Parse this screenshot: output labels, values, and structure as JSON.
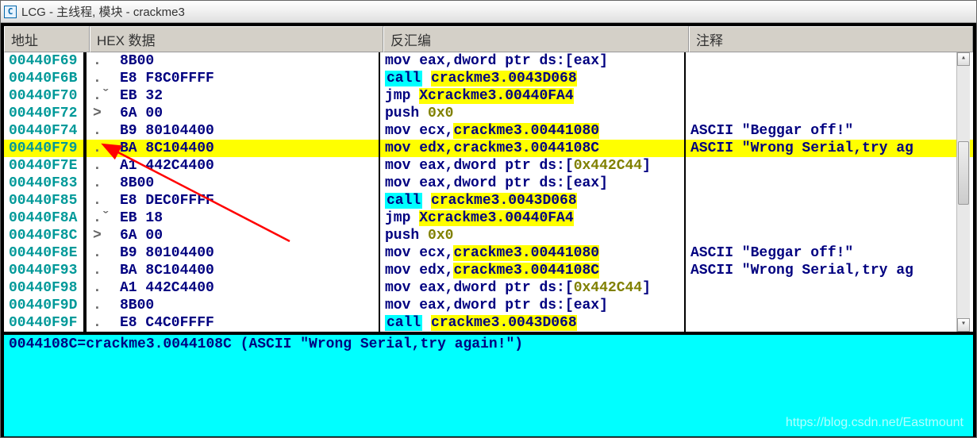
{
  "window": {
    "icon_letter": "C",
    "title": "LCG -  主线程, 模块 - crackme3"
  },
  "columns": {
    "addr": "地址",
    "hex": "HEX 数据",
    "dis": "反汇编",
    "comment": "注释"
  },
  "rows": [
    {
      "addr": "00440F69",
      "mark": ".",
      "bytes": "8B00",
      "dis": [
        [
          "mn",
          "mov "
        ],
        [
          "reg",
          "eax"
        ],
        [
          "op",
          ","
        ],
        [
          "reg",
          "dword ptr ds:"
        ],
        [
          "op",
          "["
        ],
        [
          "reg",
          "eax"
        ],
        [
          "op",
          "]"
        ]
      ],
      "comment": "",
      "sel": false
    },
    {
      "addr": "00440F6B",
      "mark": ".",
      "bytes": "E8 F8C0FFFF",
      "dis": [
        [
          "kw-call",
          "call"
        ],
        [
          "op",
          " "
        ],
        [
          "sym",
          "crackme3.0043D068"
        ]
      ],
      "comment": "",
      "sel": false
    },
    {
      "addr": "00440F70",
      "mark": ".ˇ",
      "bytes": "EB 32",
      "dis": [
        [
          "kw-jmp",
          "jmp "
        ],
        [
          "sym",
          "Xcrackme3.00440FA4"
        ]
      ],
      "comment": "",
      "sel": false
    },
    {
      "addr": "00440F72",
      "mark": ">",
      "bytes": "6A 00",
      "dis": [
        [
          "mn",
          "push "
        ],
        [
          "num",
          "0x0"
        ]
      ],
      "comment": "",
      "sel": false
    },
    {
      "addr": "00440F74",
      "mark": ".",
      "bytes": "B9 80104400",
      "dis": [
        [
          "mn",
          "mov "
        ],
        [
          "reg",
          "ecx"
        ],
        [
          "op",
          ","
        ],
        [
          "sym",
          "crackme3.00441080"
        ]
      ],
      "comment": "ASCII \"Beggar off!\"",
      "sel": false
    },
    {
      "addr": "00440F79",
      "mark": ".",
      "bytes": "BA 8C104400",
      "dis": [
        [
          "mn",
          "mov "
        ],
        [
          "reg",
          "edx"
        ],
        [
          "op",
          ","
        ],
        [
          "op",
          "crackme3.0044108C"
        ]
      ],
      "comment": "ASCII \"Wrong Serial,try ag",
      "sel": true
    },
    {
      "addr": "00440F7E",
      "mark": ".",
      "bytes": "A1 442C4400",
      "dis": [
        [
          "mn",
          "mov "
        ],
        [
          "reg",
          "eax"
        ],
        [
          "op",
          ","
        ],
        [
          "reg",
          "dword ptr ds:"
        ],
        [
          "op",
          "["
        ],
        [
          "num",
          "0x442C44"
        ],
        [
          "op",
          "]"
        ]
      ],
      "comment": "",
      "sel": false
    },
    {
      "addr": "00440F83",
      "mark": ".",
      "bytes": "8B00",
      "dis": [
        [
          "mn",
          "mov "
        ],
        [
          "reg",
          "eax"
        ],
        [
          "op",
          ","
        ],
        [
          "reg",
          "dword ptr ds:"
        ],
        [
          "op",
          "["
        ],
        [
          "reg",
          "eax"
        ],
        [
          "op",
          "]"
        ]
      ],
      "comment": "",
      "sel": false
    },
    {
      "addr": "00440F85",
      "mark": ".",
      "bytes": "E8 DEC0FFFF",
      "dis": [
        [
          "kw-call",
          "call"
        ],
        [
          "op",
          " "
        ],
        [
          "sym",
          "crackme3.0043D068"
        ]
      ],
      "comment": "",
      "sel": false
    },
    {
      "addr": "00440F8A",
      "mark": ".ˇ",
      "bytes": "EB 18",
      "dis": [
        [
          "kw-jmp",
          "jmp "
        ],
        [
          "sym",
          "Xcrackme3.00440FA4"
        ]
      ],
      "comment": "",
      "sel": false
    },
    {
      "addr": "00440F8C",
      "mark": ">",
      "bytes": "6A 00",
      "dis": [
        [
          "mn",
          "push "
        ],
        [
          "num",
          "0x0"
        ]
      ],
      "comment": "",
      "sel": false
    },
    {
      "addr": "00440F8E",
      "mark": ".",
      "bytes": "B9 80104400",
      "dis": [
        [
          "mn",
          "mov "
        ],
        [
          "reg",
          "ecx"
        ],
        [
          "op",
          ","
        ],
        [
          "sym",
          "crackme3.00441080"
        ]
      ],
      "comment": "ASCII \"Beggar off!\"",
      "sel": false
    },
    {
      "addr": "00440F93",
      "mark": ".",
      "bytes": "BA 8C104400",
      "dis": [
        [
          "mn",
          "mov "
        ],
        [
          "reg",
          "edx"
        ],
        [
          "op",
          ","
        ],
        [
          "sym",
          "crackme3.0044108C"
        ]
      ],
      "comment": "ASCII \"Wrong Serial,try ag",
      "sel": false
    },
    {
      "addr": "00440F98",
      "mark": ".",
      "bytes": "A1 442C4400",
      "dis": [
        [
          "mn",
          "mov "
        ],
        [
          "reg",
          "eax"
        ],
        [
          "op",
          ","
        ],
        [
          "reg",
          "dword ptr ds:"
        ],
        [
          "op",
          "["
        ],
        [
          "num",
          "0x442C44"
        ],
        [
          "op",
          "]"
        ]
      ],
      "comment": "",
      "sel": false
    },
    {
      "addr": "00440F9D",
      "mark": ".",
      "bytes": "8B00",
      "dis": [
        [
          "mn",
          "mov "
        ],
        [
          "reg",
          "eax"
        ],
        [
          "op",
          ","
        ],
        [
          "reg",
          "dword ptr ds:"
        ],
        [
          "op",
          "["
        ],
        [
          "reg",
          "eax"
        ],
        [
          "op",
          "]"
        ]
      ],
      "comment": "",
      "sel": false
    },
    {
      "addr": "00440F9F",
      "mark": ".",
      "bytes": "E8 C4C0FFFF",
      "dis": [
        [
          "kw-call",
          "call"
        ],
        [
          "op",
          " "
        ],
        [
          "sym",
          "crackme3.0043D068"
        ]
      ],
      "comment": "",
      "sel": false
    }
  ],
  "status": "0044108C=crackme3.0044108C (ASCII \"Wrong Serial,try again!\")",
  "watermark": "https://blog.csdn.net/Eastmount"
}
